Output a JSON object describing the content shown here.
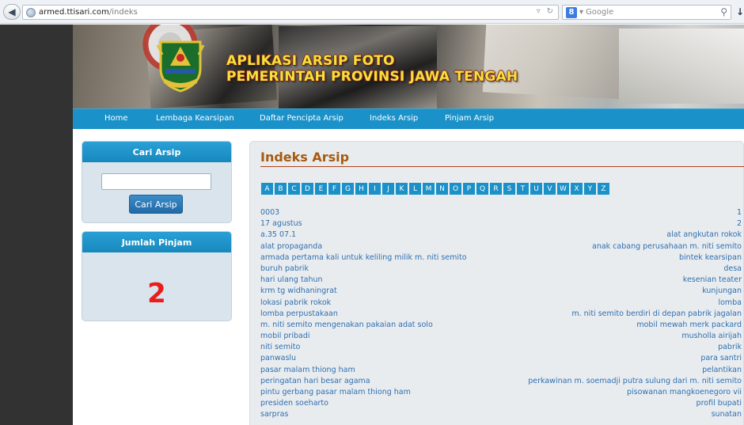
{
  "browser": {
    "url_host": "armed.",
    "url_host_bold": "ttisari.com",
    "url_path": "/indeks",
    "search_placeholder": "Google"
  },
  "banner": {
    "title_line1": "APLIKASI ARSIP FOTO",
    "title_line2": "PEMERINTAH PROVINSI JAWA TENGAH"
  },
  "nav": {
    "items": [
      {
        "label": "Home"
      },
      {
        "label": "Lembaga Kearsipan"
      },
      {
        "label": "Daftar Pencipta Arsip"
      },
      {
        "label": "Indeks Arsip"
      },
      {
        "label": "Pinjam Arsip"
      }
    ]
  },
  "sidebar": {
    "search_title": "Cari Arsip",
    "search_button": "Cari Arsip",
    "search_value": "",
    "pinjam_title": "Jumlah Pinjam",
    "pinjam_count": "2"
  },
  "content": {
    "title": "Indeks Arsip",
    "letters": [
      "A",
      "B",
      "C",
      "D",
      "E",
      "F",
      "G",
      "H",
      "I",
      "J",
      "K",
      "L",
      "M",
      "N",
      "O",
      "P",
      "Q",
      "R",
      "S",
      "T",
      "U",
      "V",
      "W",
      "X",
      "Y",
      "Z"
    ],
    "rows": [
      {
        "left": "0003",
        "right": "1"
      },
      {
        "left": "17 agustus",
        "right": "2"
      },
      {
        "left": "a.35 07.1",
        "right": "alat angkutan rokok"
      },
      {
        "left": "alat propaganda",
        "right": "anak cabang perusahaan m. niti semito"
      },
      {
        "left": "armada pertama kali untuk keliling milik m. niti semito",
        "right": "bintek kearsipan"
      },
      {
        "left": "buruh pabrik",
        "right": "desa"
      },
      {
        "left": "hari ulang tahun",
        "right": "kesenian teater"
      },
      {
        "left": "krm tg widhaningrat",
        "right": "kunjungan"
      },
      {
        "left": "lokasi pabrik rokok",
        "right": "lomba"
      },
      {
        "left": "lomba perpustakaan",
        "right": "m. niti semito berdiri di depan pabrik jagalan"
      },
      {
        "left": "m. niti semito mengenakan pakaian adat solo",
        "right": "mobil mewah merk packard"
      },
      {
        "left": "mobil pribadi",
        "right": "musholla airijah"
      },
      {
        "left": "niti semito",
        "right": "pabrik"
      },
      {
        "left": "panwaslu",
        "right": "para santri"
      },
      {
        "left": "pasar malam thiong ham",
        "right": "pelantikan"
      },
      {
        "left": "peringatan hari besar agama",
        "right": "perkawinan m. soemadji putra sulung dari m. niti semito"
      },
      {
        "left": "pintu gerbang pasar malam thiong ham",
        "right": "pisowanan mangkoenegoro vii"
      },
      {
        "left": "presiden soeharto",
        "right": "profil bupati"
      },
      {
        "left": "sarpras",
        "right": "sunatan"
      }
    ]
  }
}
